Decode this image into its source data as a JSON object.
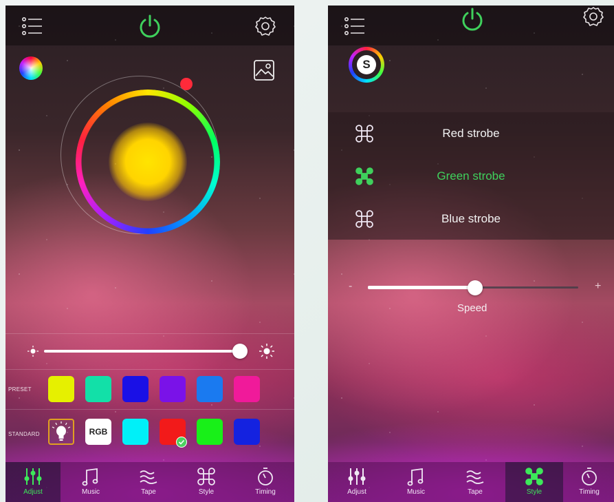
{
  "left_screen": {
    "icons": {
      "menu": "list-menu-icon",
      "power": "power-icon",
      "settings": "gear-icon",
      "color_picker": "color-circle-icon",
      "image": "image-icon",
      "brightness_low": "sun-small-icon",
      "brightness_high": "sun-large-icon"
    },
    "colors": {
      "power": "#3fd05c",
      "wheel_handle": "#ff2a3a",
      "center_color": "#ffd400"
    },
    "brightness_value": 1.0,
    "preset": {
      "label": "PRESET",
      "swatches": [
        "#e6f000",
        "#12e0a8",
        "#1a10e6",
        "#7a12e8",
        "#1a7af0",
        "#f01a9a"
      ]
    },
    "standard": {
      "label": "STANDARD",
      "bulb_icon": "bulb-icon",
      "rgb_label": "RGB",
      "swatches": [
        "#00f0f8",
        "#f21a1a",
        "#18f018",
        "#1422e0"
      ],
      "selected_color": "#f21a1a"
    },
    "nav": [
      {
        "label": "Adjust",
        "icon": "equalizer-icon",
        "active": true
      },
      {
        "label": "Music",
        "icon": "music-note-icon",
        "active": false
      },
      {
        "label": "Tape",
        "icon": "tape-icon",
        "active": false
      },
      {
        "label": "Style",
        "icon": "command-icon",
        "active": false
      },
      {
        "label": "Timing",
        "icon": "timer-icon",
        "active": false
      }
    ]
  },
  "right_screen": {
    "style_badge": "S",
    "strobes": [
      {
        "label": "Red strobe",
        "selected": false
      },
      {
        "label": "Green strobe",
        "selected": true
      },
      {
        "label": "Blue strobe",
        "selected": false
      }
    ],
    "speed": {
      "minus": "-",
      "plus": "+",
      "label": "Speed",
      "value": 0.51
    },
    "nav": [
      {
        "label": "Adjust",
        "icon": "equalizer-icon",
        "active": false
      },
      {
        "label": "Music",
        "icon": "music-note-icon",
        "active": false
      },
      {
        "label": "Tape",
        "icon": "tape-icon",
        "active": false
      },
      {
        "label": "Style",
        "icon": "command-icon",
        "active": true
      },
      {
        "label": "Timing",
        "icon": "timer-icon",
        "active": false
      }
    ]
  }
}
